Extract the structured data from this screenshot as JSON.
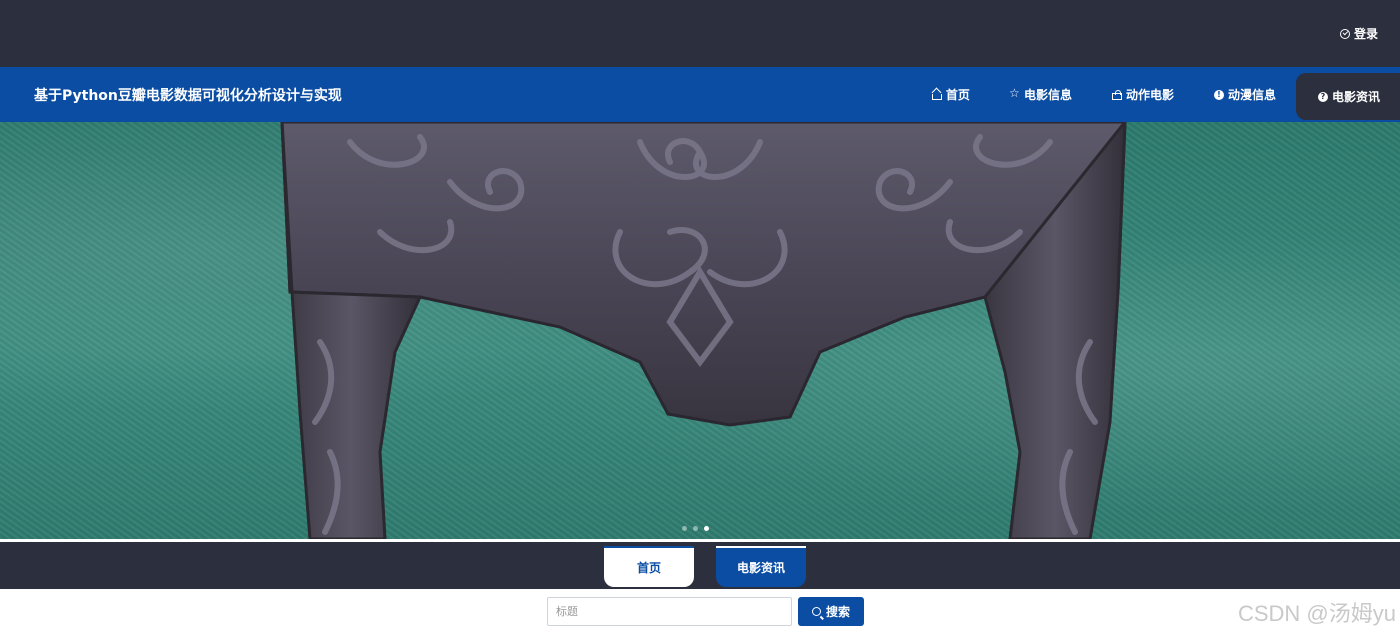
{
  "topbar": {
    "login_label": "登录"
  },
  "header": {
    "title": "基于Python豆瓣电影数据可视化分析设计与实现",
    "nav": [
      {
        "label": "首页",
        "icon": "home-icon"
      },
      {
        "label": "电影信息",
        "icon": "star-icon"
      },
      {
        "label": "动作电影",
        "icon": "bag-icon"
      },
      {
        "label": "动漫信息",
        "icon": "info-icon"
      },
      {
        "label": "电影资讯",
        "icon": "help-icon",
        "active": true
      }
    ]
  },
  "banner": {
    "slides": 3,
    "active_slide": 2
  },
  "tabs": [
    {
      "label": "首页"
    },
    {
      "label": "电影资讯",
      "active": true
    }
  ],
  "search": {
    "placeholder": "标题",
    "button_label": "搜索"
  },
  "watermark": "CSDN @汤姆yu",
  "colors": {
    "primary": "#0a4da3",
    "dark": "#2b2f3e",
    "teal": "#2f7b6f"
  }
}
